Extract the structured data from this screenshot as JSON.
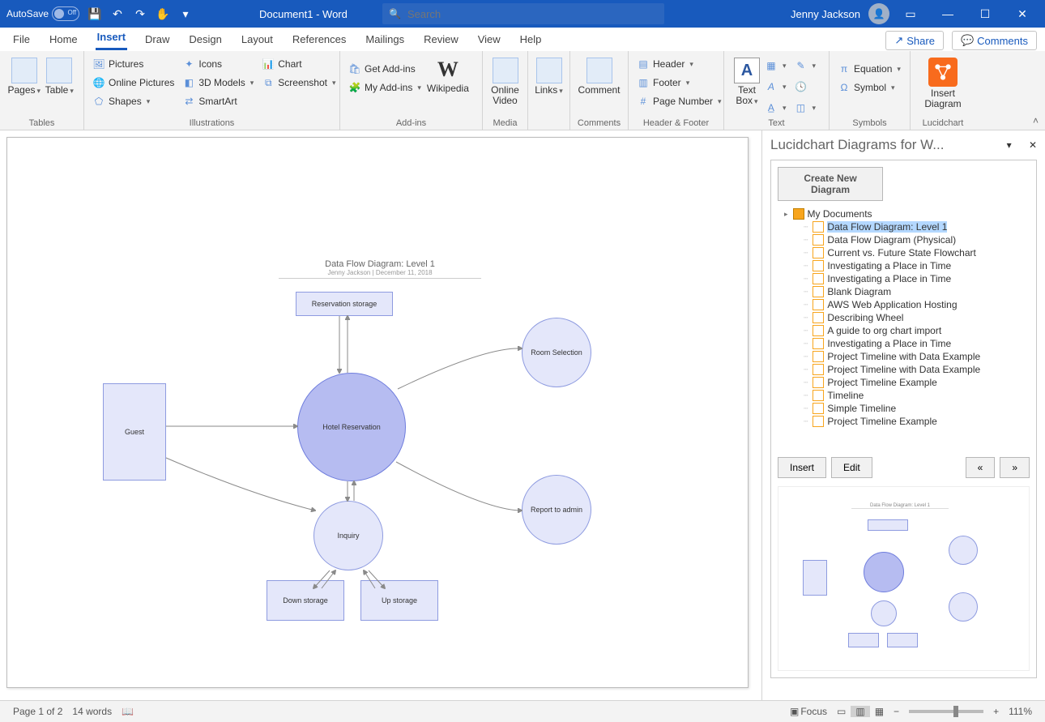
{
  "titlebar": {
    "autosave_label": "AutoSave",
    "autosave_state": "Off",
    "doc_title": "Document1  -  Word",
    "search_placeholder": "Search",
    "user_name": "Jenny Jackson"
  },
  "menu_tabs": {
    "file": "File",
    "home": "Home",
    "insert": "Insert",
    "draw": "Draw",
    "design": "Design",
    "layout": "Layout",
    "references": "References",
    "mailings": "Mailings",
    "review": "Review",
    "view": "View",
    "help": "Help",
    "share": "Share",
    "comments": "Comments"
  },
  "ribbon": {
    "groups": {
      "tables": {
        "label": "Tables",
        "pages": "Pages",
        "table": "Table"
      },
      "illus": {
        "label": "Illustrations",
        "pictures": "Pictures",
        "online_pictures": "Online Pictures",
        "shapes": "Shapes",
        "icons": "Icons",
        "models": "3D Models",
        "smartart": "SmartArt",
        "chart": "Chart",
        "screenshot": "Screenshot"
      },
      "addins": {
        "label": "Add-ins",
        "get": "Get Add-ins",
        "my": "My Add-ins",
        "wiki": "Wikipedia"
      },
      "media": {
        "label": "Media",
        "video": "Online Video"
      },
      "links": {
        "label": "",
        "links": "Links"
      },
      "comments": {
        "label": "Comments",
        "comment": "Comment"
      },
      "hf": {
        "label": "Header & Footer",
        "header": "Header",
        "footer": "Footer",
        "pagenum": "Page Number"
      },
      "text": {
        "label": "Text",
        "textbox": "Text Box"
      },
      "symbols": {
        "label": "Symbols",
        "equation": "Equation",
        "symbol": "Symbol"
      },
      "lucid": {
        "label": "Lucidchart",
        "insert_diagram": "Insert Diagram"
      }
    }
  },
  "diagram": {
    "title": "Data Flow Diagram: Level 1",
    "subtitle": "Jenny Jackson  |  December 11, 2018",
    "nodes": {
      "reservation_storage": "Reservation storage",
      "guest": "Guest",
      "hotel_reservation": "Hotel Reservation",
      "room_selection": "Room Selection",
      "report_admin": "Report to admin",
      "inquiry": "Inquiry",
      "down_storage": "Down storage",
      "up_storage": "Up storage"
    }
  },
  "pane": {
    "title": "Lucidchart Diagrams for W...",
    "create_btn": "Create New Diagram",
    "root": "My Documents",
    "items": [
      "Data Flow Diagram: Level 1",
      "Data Flow Diagram (Physical)",
      "Current vs. Future State Flowchart",
      "Investigating a Place in Time",
      "Investigating a Place in Time",
      "Blank Diagram",
      "AWS Web Application Hosting",
      "Describing Wheel",
      "A guide to org chart import",
      "Investigating a Place in Time",
      "Project Timeline with Data Example",
      "Project Timeline with Data Example",
      "Project Timeline Example",
      "Timeline",
      "Simple Timeline",
      "Project Timeline Example"
    ],
    "insert_btn": "Insert",
    "edit_btn": "Edit",
    "prev": "«",
    "next": "»"
  },
  "statusbar": {
    "page": "Page 1 of 2",
    "words": "14 words",
    "focus": "Focus",
    "zoom": "111%"
  }
}
